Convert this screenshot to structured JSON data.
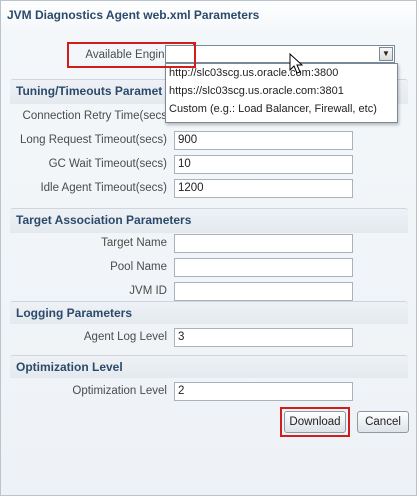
{
  "dialog": {
    "title": "JVM Diagnostics Agent web.xml Parameters"
  },
  "engines": {
    "label": "Available Engines",
    "selected": "",
    "options": [
      "http://slc03scg.us.oracle.com:3800",
      "https://slc03scg.us.oracle.com:3801",
      "Custom (e.g.: Load Balancer, Firewall, etc)"
    ]
  },
  "tuning": {
    "title": "Tuning/Timeouts Paramet",
    "connection_retry": {
      "label": "Connection Retry Time(secs",
      "value": ""
    },
    "long_request": {
      "label": "Long Request Timeout(secs)",
      "value": "900"
    },
    "gc_wait": {
      "label": "GC Wait Timeout(secs)",
      "value": "10"
    },
    "idle_agent": {
      "label": "Idle Agent Timeout(secs)",
      "value": "1200"
    }
  },
  "target": {
    "title": "Target Association Parameters",
    "target_name": {
      "label": "Target Name",
      "value": ""
    },
    "pool_name": {
      "label": "Pool Name",
      "value": ""
    },
    "jvm_id": {
      "label": "JVM ID",
      "value": ""
    }
  },
  "logging": {
    "title": "Logging Parameters",
    "agent_log_level": {
      "label": "Agent Log Level",
      "value": "3"
    }
  },
  "optimization": {
    "title": "Optimization Level",
    "optimization_level": {
      "label": "Optimization Level",
      "value": "2"
    }
  },
  "buttons": {
    "download": "Download",
    "cancel": "Cancel"
  },
  "colors": {
    "highlight": "#d01d1d",
    "section_title": "#2b4a6b"
  }
}
